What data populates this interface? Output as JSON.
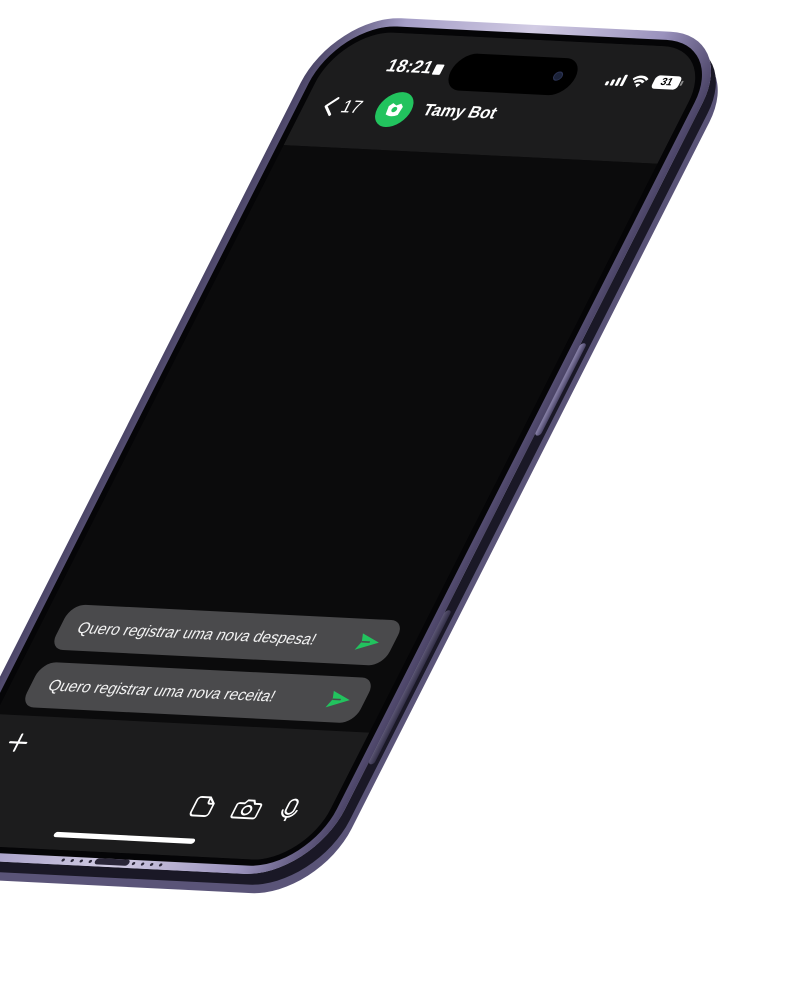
{
  "status_bar": {
    "time": "18:21",
    "battery": "31"
  },
  "header": {
    "back_count": "17",
    "contact_name": "Tamy Bot"
  },
  "suggestions": [
    {
      "label": "Quero registrar uma nova despesa!",
      "icon": "send-icon"
    },
    {
      "label": "Quero registrar uma nova receita!",
      "icon": "send-icon"
    }
  ],
  "composer": {
    "icons": [
      "plus-icon",
      "sticker-icon",
      "camera-icon",
      "microphone-icon"
    ]
  },
  "colors": {
    "accent_green": "#22c35e",
    "phone_frame": "#a59ec7",
    "screen_bg": "#0b0b0c",
    "bar_bg": "#1c1c1d",
    "bubble_bg": "#4a4a4c"
  }
}
